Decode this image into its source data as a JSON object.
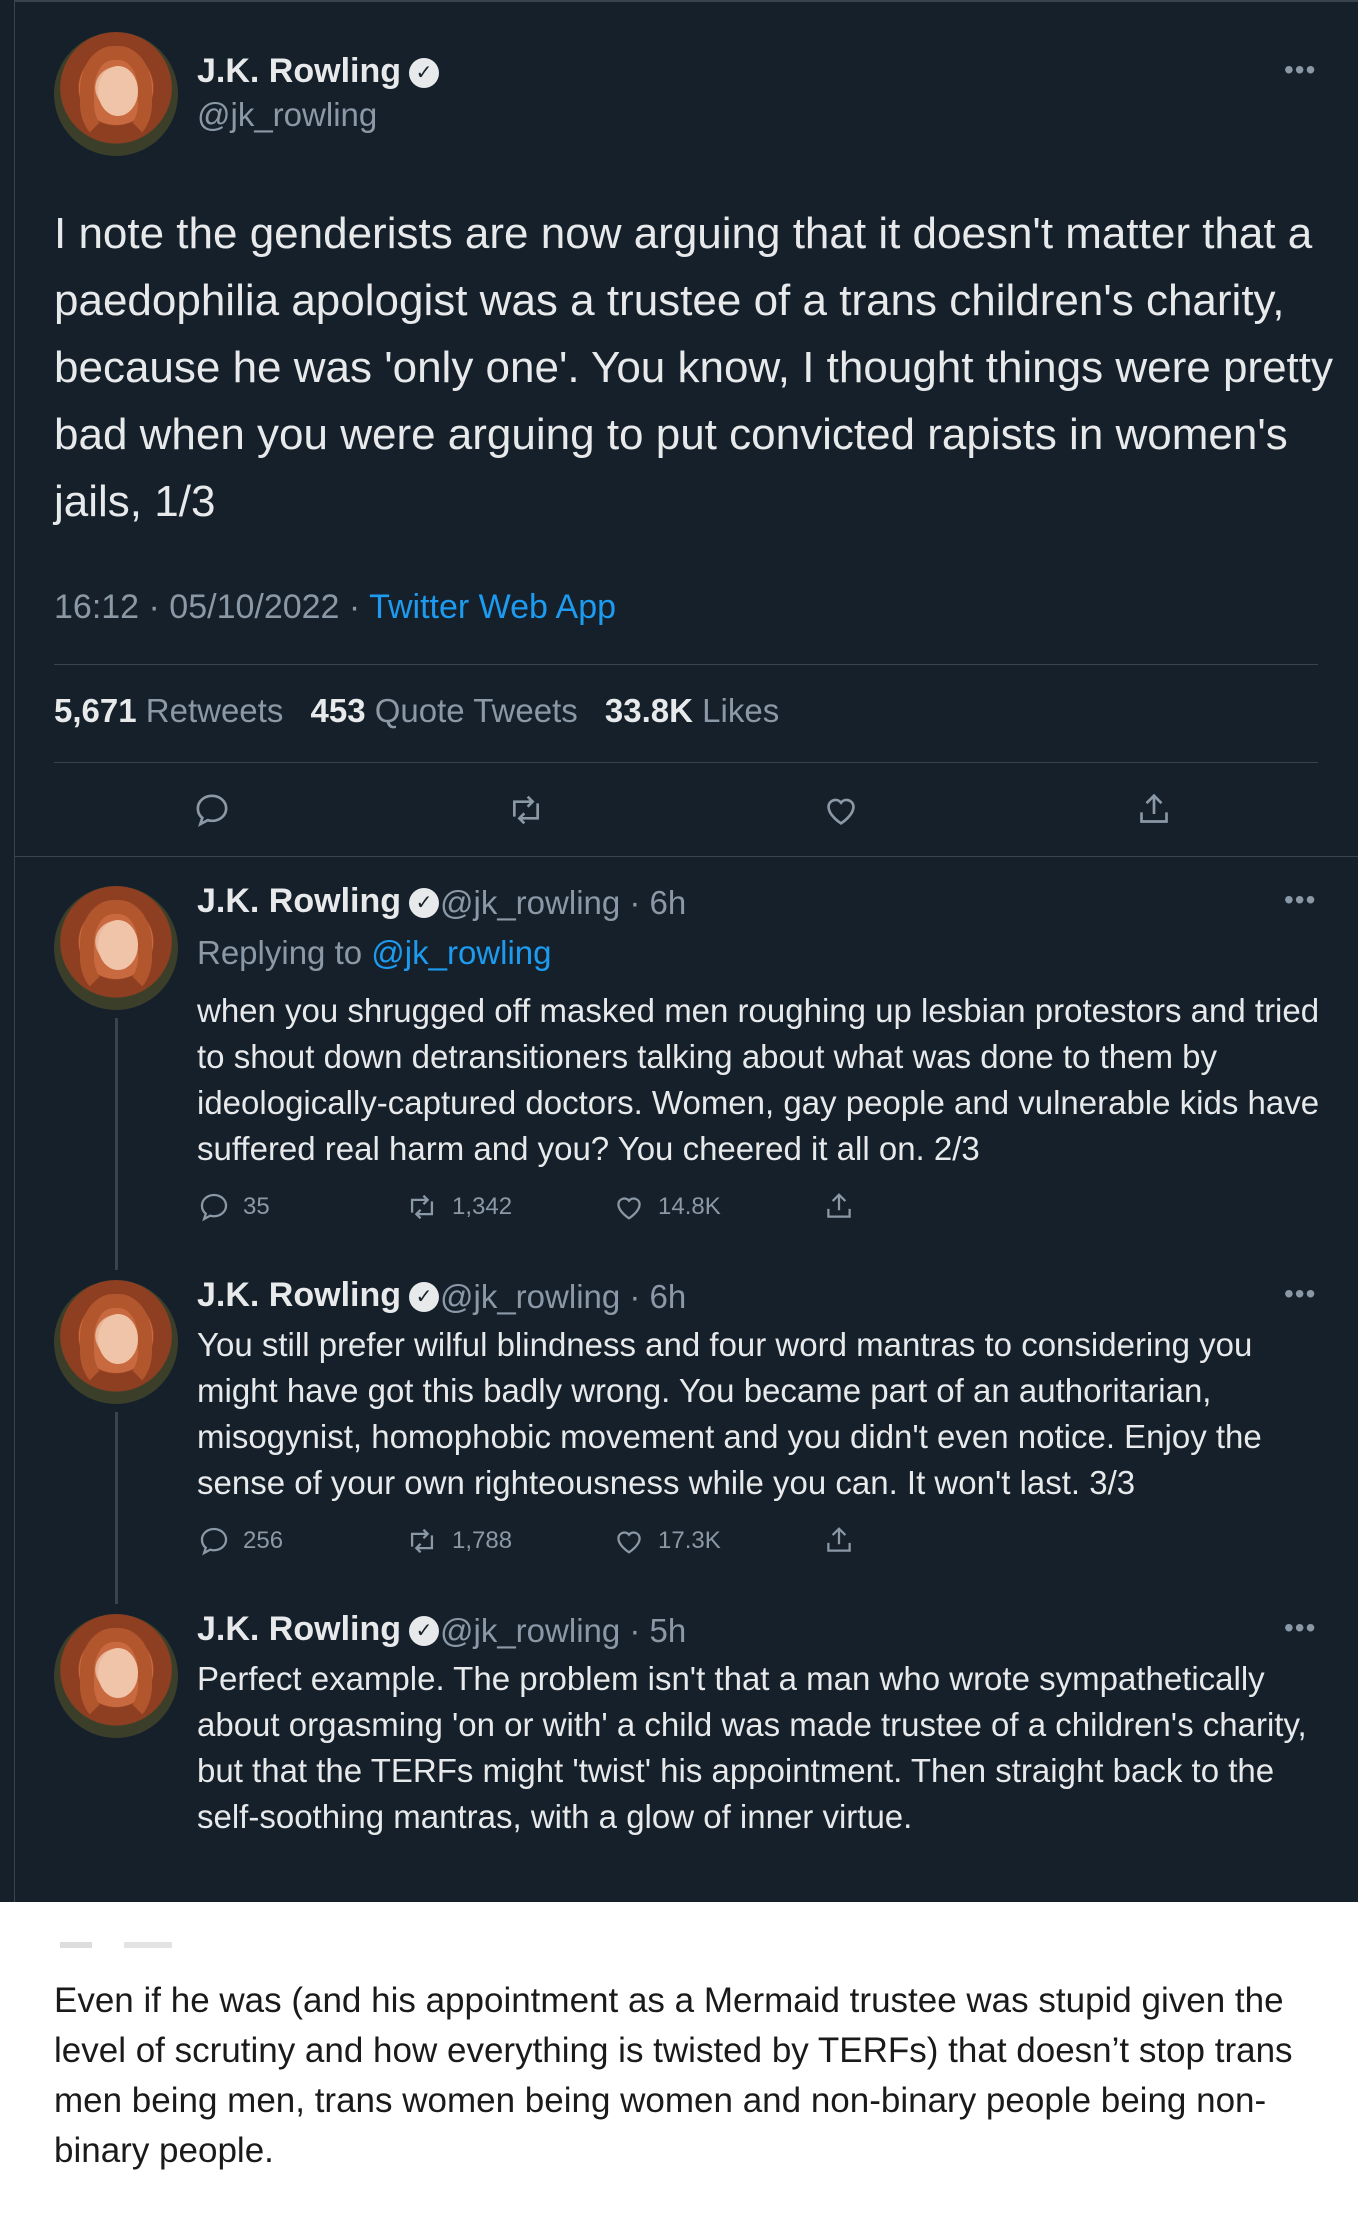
{
  "main_tweet": {
    "author": "J.K. Rowling",
    "verified_glyph": "✓",
    "handle": "@jk_rowling",
    "text": "I note the genderists are now arguing that it doesn't matter that a paedophilia apologist was a trustee of a trans children's charity, because he was 'only one'. You know, I thought things were pretty bad when you were arguing to put convicted rapists in women's jails, 1/3",
    "time": "16:12 · 05/10/2022 · ",
    "source": "Twitter Web App",
    "stats": {
      "retweets_count": "5,671",
      "retweets_label": "Retweets",
      "quotes_count": "453",
      "quotes_label": "Quote Tweets",
      "likes_count": "33.8K",
      "likes_label": "Likes"
    },
    "icons": [
      "reply-icon",
      "retweet-icon",
      "like-icon",
      "share-icon"
    ]
  },
  "replies": [
    {
      "author": "J.K. Rowling",
      "meta": "@jk_rowling · 6h",
      "replying_label": "Replying to ",
      "replying_handle": "@jk_rowling",
      "text": "when you shrugged off masked men roughing up lesbian protestors and tried to shout down detransitioners talking about what was done to them by ideologically-captured doctors. Women, gay people and vulnerable kids have suffered real harm and you? You cheered it all on. 2/3",
      "replies": "35",
      "retweets": "1,342",
      "likes": "14.8K"
    },
    {
      "author": "J.K. Rowling",
      "meta": "@jk_rowling · 6h",
      "text": "You still prefer wilful blindness and four word mantras to considering you might have got this badly wrong. You became part of an authoritarian, misogynist, homophobic movement and you didn't even notice. Enjoy the sense of your own righteousness while you can. It won't last. 3/3",
      "replies": "256",
      "retweets": "1,788",
      "likes": "17.3K"
    },
    {
      "author": "J.K. Rowling",
      "meta": "@jk_rowling · 5h",
      "text": "Perfect example. The problem isn't that a man who  wrote sympathetically about orgasming 'on or with' a child was made trustee of a children's charity, but that the TERFs might 'twist' his appointment. Then straight back to the self-soothing mantras, with a glow of inner virtue."
    }
  ],
  "quoted_post": {
    "text": "Even if he was (and his appointment as a Mermaid trustee was stupid given the level of scrutiny and how everything is twisted by TERFs) that doesn’t stop trans men being men, trans women being women and non-binary people being non-binary people."
  },
  "colors": {
    "background": "#15202b",
    "text": "#e7e9ea",
    "muted": "#8b98a5",
    "link": "#1d9bf0",
    "divider": "#38444d"
  }
}
